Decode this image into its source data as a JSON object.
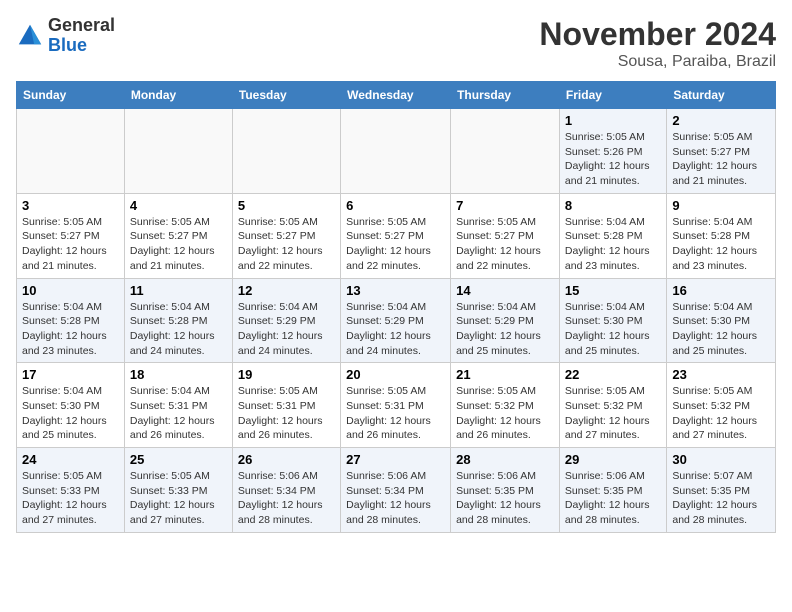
{
  "logo": {
    "general": "General",
    "blue": "Blue"
  },
  "header": {
    "month_title": "November 2024",
    "location": "Sousa, Paraiba, Brazil"
  },
  "days_of_week": [
    "Sunday",
    "Monday",
    "Tuesday",
    "Wednesday",
    "Thursday",
    "Friday",
    "Saturday"
  ],
  "weeks": [
    [
      {
        "day": "",
        "info": ""
      },
      {
        "day": "",
        "info": ""
      },
      {
        "day": "",
        "info": ""
      },
      {
        "day": "",
        "info": ""
      },
      {
        "day": "",
        "info": ""
      },
      {
        "day": "1",
        "info": "Sunrise: 5:05 AM\nSunset: 5:26 PM\nDaylight: 12 hours and 21 minutes."
      },
      {
        "day": "2",
        "info": "Sunrise: 5:05 AM\nSunset: 5:27 PM\nDaylight: 12 hours and 21 minutes."
      }
    ],
    [
      {
        "day": "3",
        "info": "Sunrise: 5:05 AM\nSunset: 5:27 PM\nDaylight: 12 hours and 21 minutes."
      },
      {
        "day": "4",
        "info": "Sunrise: 5:05 AM\nSunset: 5:27 PM\nDaylight: 12 hours and 21 minutes."
      },
      {
        "day": "5",
        "info": "Sunrise: 5:05 AM\nSunset: 5:27 PM\nDaylight: 12 hours and 22 minutes."
      },
      {
        "day": "6",
        "info": "Sunrise: 5:05 AM\nSunset: 5:27 PM\nDaylight: 12 hours and 22 minutes."
      },
      {
        "day": "7",
        "info": "Sunrise: 5:05 AM\nSunset: 5:27 PM\nDaylight: 12 hours and 22 minutes."
      },
      {
        "day": "8",
        "info": "Sunrise: 5:04 AM\nSunset: 5:28 PM\nDaylight: 12 hours and 23 minutes."
      },
      {
        "day": "9",
        "info": "Sunrise: 5:04 AM\nSunset: 5:28 PM\nDaylight: 12 hours and 23 minutes."
      }
    ],
    [
      {
        "day": "10",
        "info": "Sunrise: 5:04 AM\nSunset: 5:28 PM\nDaylight: 12 hours and 23 minutes."
      },
      {
        "day": "11",
        "info": "Sunrise: 5:04 AM\nSunset: 5:28 PM\nDaylight: 12 hours and 24 minutes."
      },
      {
        "day": "12",
        "info": "Sunrise: 5:04 AM\nSunset: 5:29 PM\nDaylight: 12 hours and 24 minutes."
      },
      {
        "day": "13",
        "info": "Sunrise: 5:04 AM\nSunset: 5:29 PM\nDaylight: 12 hours and 24 minutes."
      },
      {
        "day": "14",
        "info": "Sunrise: 5:04 AM\nSunset: 5:29 PM\nDaylight: 12 hours and 25 minutes."
      },
      {
        "day": "15",
        "info": "Sunrise: 5:04 AM\nSunset: 5:30 PM\nDaylight: 12 hours and 25 minutes."
      },
      {
        "day": "16",
        "info": "Sunrise: 5:04 AM\nSunset: 5:30 PM\nDaylight: 12 hours and 25 minutes."
      }
    ],
    [
      {
        "day": "17",
        "info": "Sunrise: 5:04 AM\nSunset: 5:30 PM\nDaylight: 12 hours and 25 minutes."
      },
      {
        "day": "18",
        "info": "Sunrise: 5:04 AM\nSunset: 5:31 PM\nDaylight: 12 hours and 26 minutes."
      },
      {
        "day": "19",
        "info": "Sunrise: 5:05 AM\nSunset: 5:31 PM\nDaylight: 12 hours and 26 minutes."
      },
      {
        "day": "20",
        "info": "Sunrise: 5:05 AM\nSunset: 5:31 PM\nDaylight: 12 hours and 26 minutes."
      },
      {
        "day": "21",
        "info": "Sunrise: 5:05 AM\nSunset: 5:32 PM\nDaylight: 12 hours and 26 minutes."
      },
      {
        "day": "22",
        "info": "Sunrise: 5:05 AM\nSunset: 5:32 PM\nDaylight: 12 hours and 27 minutes."
      },
      {
        "day": "23",
        "info": "Sunrise: 5:05 AM\nSunset: 5:32 PM\nDaylight: 12 hours and 27 minutes."
      }
    ],
    [
      {
        "day": "24",
        "info": "Sunrise: 5:05 AM\nSunset: 5:33 PM\nDaylight: 12 hours and 27 minutes."
      },
      {
        "day": "25",
        "info": "Sunrise: 5:05 AM\nSunset: 5:33 PM\nDaylight: 12 hours and 27 minutes."
      },
      {
        "day": "26",
        "info": "Sunrise: 5:06 AM\nSunset: 5:34 PM\nDaylight: 12 hours and 28 minutes."
      },
      {
        "day": "27",
        "info": "Sunrise: 5:06 AM\nSunset: 5:34 PM\nDaylight: 12 hours and 28 minutes."
      },
      {
        "day": "28",
        "info": "Sunrise: 5:06 AM\nSunset: 5:35 PM\nDaylight: 12 hours and 28 minutes."
      },
      {
        "day": "29",
        "info": "Sunrise: 5:06 AM\nSunset: 5:35 PM\nDaylight: 12 hours and 28 minutes."
      },
      {
        "day": "30",
        "info": "Sunrise: 5:07 AM\nSunset: 5:35 PM\nDaylight: 12 hours and 28 minutes."
      }
    ]
  ]
}
